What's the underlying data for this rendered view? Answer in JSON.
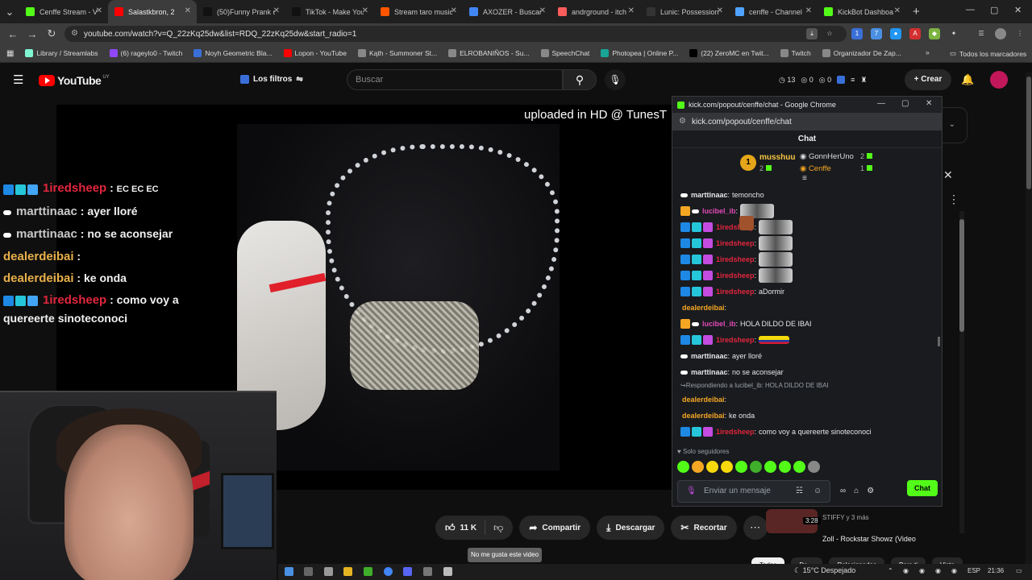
{
  "browser": {
    "tabs": [
      {
        "label": "Cenffe Stream - V",
        "color": "#53fc18",
        "active": false
      },
      {
        "label": "Salastkbron, 2",
        "color": "#ff0000",
        "active": true
      },
      {
        "label": "(50)Funny Prank c",
        "color": "#111111",
        "active": false
      },
      {
        "label": "TikTok - Make You",
        "color": "#111111",
        "active": false
      },
      {
        "label": "Stream taro music",
        "color": "#ff5500",
        "active": false
      },
      {
        "label": "AXOZER - Buscar",
        "color": "#4285f4",
        "active": false
      },
      {
        "label": "andrground - itch",
        "color": "#fa5c5c",
        "active": false
      },
      {
        "label": "Lunic: Possession",
        "color": "#333333",
        "active": false
      },
      {
        "label": "cenffe - Channel",
        "color": "#4fa3ff",
        "active": false
      },
      {
        "label": "KickBot Dashboa",
        "color": "#53fc18",
        "active": false
      }
    ],
    "url": "youtube.com/watch?v=Q_22zKq25dw&list=RDQ_22zKq25dw&start_radio=1",
    "bookmarks": [
      {
        "label": "Library / Streamlabs",
        "color": "#80f5d2"
      },
      {
        "label": "(6) rageylo0 - Twitch",
        "color": "#9146ff"
      },
      {
        "label": "Noyh Geometric Bla...",
        "color": "#3a6fd8"
      },
      {
        "label": "Lopon - YouTube",
        "color": "#ff0000"
      },
      {
        "label": "Kąth - Summoner St...",
        "color": "#888888"
      },
      {
        "label": "ELROBANIÑOS - Su...",
        "color": "#888888"
      },
      {
        "label": "SpeechChat",
        "color": "#888888"
      },
      {
        "label": "Photopea | Online P...",
        "color": "#18a497"
      },
      {
        "label": "(22) ZeroMC en Twit...",
        "color": "#000000"
      },
      {
        "label": "Twitch",
        "color": "#888888"
      },
      {
        "label": "Organizador De Zap...",
        "color": "#888888"
      }
    ],
    "all_bookmarks": "Todos los marcadores"
  },
  "youtube": {
    "logo_text": "YouTube",
    "country": "UY",
    "filters_label": "Los filtros",
    "search_placeholder": "Buscar",
    "stats": [
      "13",
      "0",
      "0"
    ],
    "create_label": "Crear",
    "video_overlay_title": "uploaded in HD @ TunesT",
    "actions": {
      "likes": "11 K",
      "share": "Compartir",
      "download": "Descargar",
      "clip": "Recortar"
    },
    "tooltip": "No me gusta este video",
    "suggestion": {
      "duration": "3:28",
      "meta": "STIFFY y 3 más",
      "title": "Zoll - Rockstar Showz (Video"
    },
    "chips": [
      "Todos",
      "De ...",
      "Relacionados",
      "Para ti",
      "Visto"
    ]
  },
  "overlay_chat": [
    {
      "user": "1iredsheep",
      "user_color": "red",
      "text": "EC EC EC",
      "badges": [
        "#1e88e5",
        "#26c6da",
        "#42a5f5"
      ],
      "small": true
    },
    {
      "user": "marttinaac",
      "user_color": "gray",
      "text": "ayer lloré",
      "badges": [
        "#ffffff"
      ]
    },
    {
      "user": "marttinaac",
      "user_color": "gray",
      "text": "no se aconsejar",
      "badges": [
        "#ffffff"
      ]
    },
    {
      "user": "dealerdeibai",
      "user_color": "gold",
      "text": "",
      "badges": []
    },
    {
      "user": "dealerdeibai",
      "user_color": "gold",
      "text": "ke onda",
      "badges": []
    },
    {
      "user": "1iredsheep",
      "user_color": "red",
      "text": "como voy a quereerte sinoteconoci",
      "badges": [
        "#1e88e5",
        "#26c6da",
        "#42a5f5"
      ]
    }
  ],
  "kick": {
    "window_title": "kick.com/popout/cenffe/chat - Google Chrome",
    "url": "kick.com/popout/cenffe/chat",
    "header": "Chat",
    "leaderboard": {
      "first": {
        "rank": "1",
        "name": "musshuu",
        "count": "2"
      },
      "second": {
        "name": "GonnHerUno",
        "count": "2"
      },
      "third": {
        "name": "Cenffe",
        "count": "1"
      }
    },
    "messages": [
      {
        "user": "marttinaac",
        "color": "#e6e6e6",
        "text": "temoncho",
        "badges": [
          "#ffffff"
        ]
      },
      {
        "user": "lucibel_ib",
        "color": "#e04ab4",
        "text": "",
        "emote": "gif",
        "badges": [
          "#f5a623",
          "#ffffff"
        ]
      },
      {
        "user": "1iredsheep",
        "color": "#e2263d",
        "text": "",
        "emote": "gif",
        "badges": [
          "#1e88e5",
          "#26c6da",
          "#c44ce0"
        ]
      },
      {
        "user": "1iredsheep",
        "color": "#e2263d",
        "text": "",
        "emote": "gif",
        "badges": [
          "#1e88e5",
          "#26c6da",
          "#c44ce0"
        ]
      },
      {
        "user": "1iredsheep",
        "color": "#e2263d",
        "text": "",
        "emote": "gif",
        "badges": [
          "#1e88e5",
          "#26c6da",
          "#c44ce0"
        ]
      },
      {
        "user": "1iredsheep",
        "color": "#e2263d",
        "text": "",
        "emote": "gif",
        "badges": [
          "#1e88e5",
          "#26c6da",
          "#c44ce0"
        ]
      },
      {
        "user": "1iredsheep",
        "color": "#e2263d",
        "text": "aDormir",
        "badges": [
          "#1e88e5",
          "#26c6da",
          "#c44ce0"
        ]
      },
      {
        "user": "dealerdeibai",
        "color": "#f5a623",
        "text": "",
        "emote": "face",
        "badges": []
      },
      {
        "user": "lucibel_ib",
        "color": "#e04ab4",
        "text": "HOLA DILDO DE IBAI",
        "badges": [
          "#f5a623",
          "#ffffff"
        ]
      },
      {
        "user": "1iredsheep",
        "color": "#e2263d",
        "text": "",
        "emote": "flag",
        "badges": [
          "#1e88e5",
          "#26c6da",
          "#c44ce0"
        ]
      },
      {
        "user": "marttinaac",
        "color": "#e6e6e6",
        "text": "ayer lloré",
        "badges": [
          "#ffffff"
        ]
      },
      {
        "user": "marttinaac",
        "color": "#e6e6e6",
        "text": "no se aconsejar",
        "badges": [
          "#ffffff"
        ]
      },
      {
        "reply": "Respondiendo a lucibel_ib: HOLA DILDO DE IBAI"
      },
      {
        "user": "dealerdeibai",
        "color": "#f5a623",
        "text": "",
        "badges": []
      },
      {
        "user": "dealerdeibai",
        "color": "#f5a623",
        "text": "ke onda",
        "badges": []
      },
      {
        "user": "1iredsheep",
        "color": "#e2263d",
        "text": "como voy a quereerte sinoteconoci",
        "badges": [
          "#1e88e5",
          "#26c6da",
          "#c44ce0"
        ]
      }
    ],
    "followers_only": "Solo seguidores",
    "input_placeholder": "Enviar un mensaje",
    "send_label": "Chat",
    "emote_colors": [
      "#53fc18",
      "#f5a623",
      "#f5d90a",
      "#f5d90a",
      "#53fc18",
      "#3fae2a",
      "#53fc18",
      "#53fc18",
      "#53fc18",
      "#888888"
    ]
  },
  "taskbar": {
    "weather": "15°C  Despejado",
    "lang": "ESP",
    "time": "21:36"
  }
}
